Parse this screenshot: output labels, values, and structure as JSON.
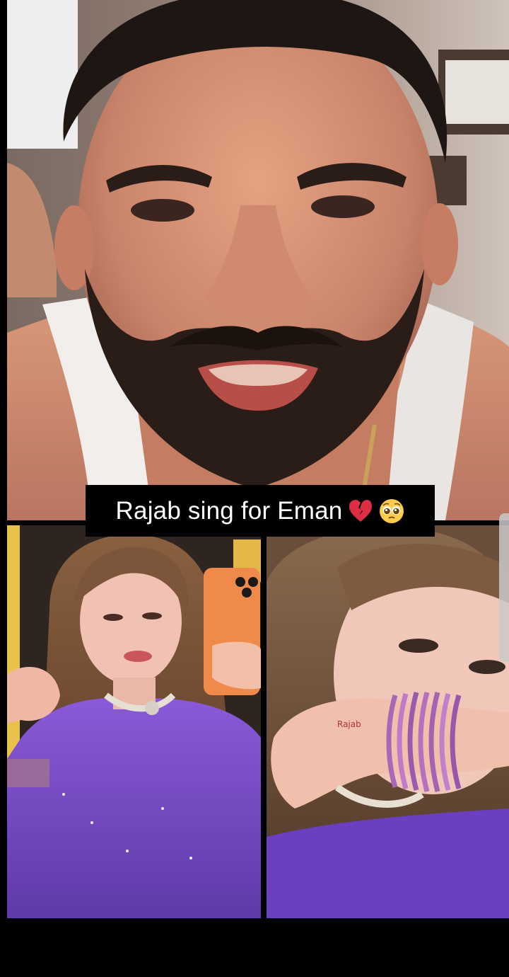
{
  "caption": {
    "text": "Rajab sing for Eman",
    "emoji_1": "broken-heart-icon",
    "emoji_2": "pleading-face-icon"
  },
  "colors": {
    "background": "#000000",
    "caption_bg": "#000000",
    "caption_text": "#ffffff",
    "outfit_purple": "#7b4fc9",
    "phone_case": "#f08a4b"
  },
  "panels": {
    "top": "man-in-white-vest",
    "bottom_left": "woman-in-purple-outfit-mirror-selfie",
    "bottom_right": "woman-covering-face-with-hand"
  }
}
